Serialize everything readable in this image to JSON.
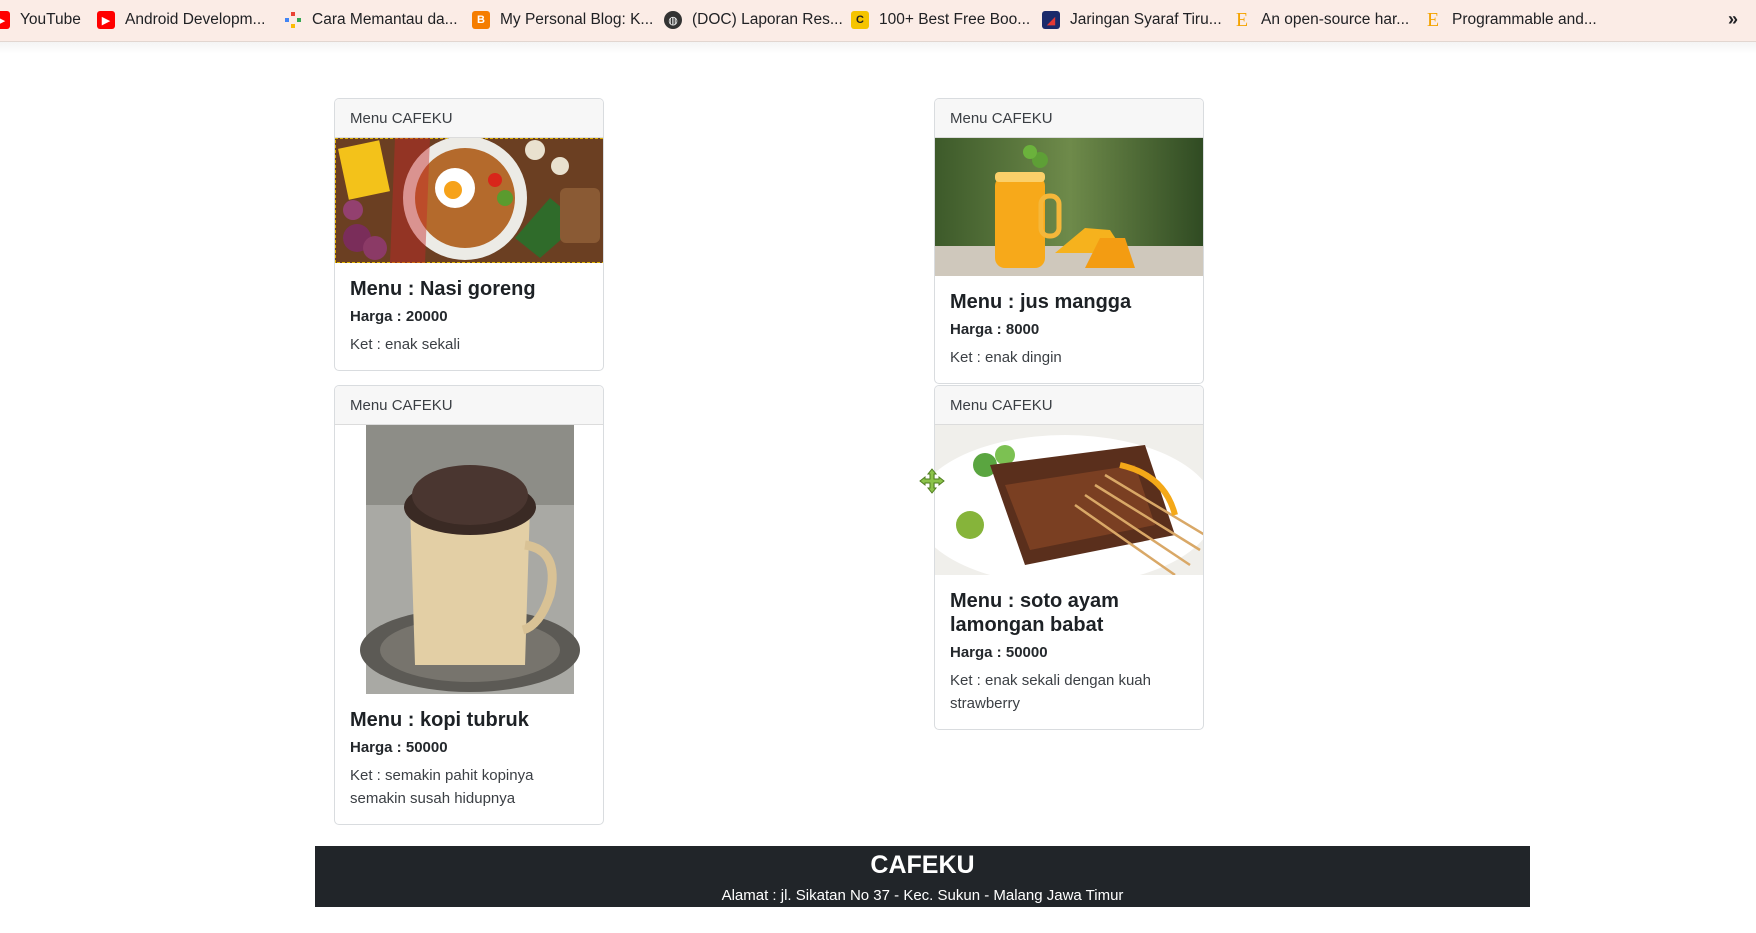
{
  "bookmarks": [
    {
      "label": "YouTube",
      "icon": "youtube-icon",
      "color": "#ff0000"
    },
    {
      "label": "Android Developm...",
      "icon": "youtube-icon",
      "color": "#ff0000"
    },
    {
      "label": "Cara Memantau da...",
      "icon": "diamond-icon",
      "color": "#4caf50"
    },
    {
      "label": "My Personal Blog: K...",
      "icon": "blogger-icon",
      "color": "#f57d00"
    },
    {
      "label": "(DOC) Laporan Res...",
      "icon": "globe-icon",
      "color": "#333333"
    },
    {
      "label": "100+ Best Free Boo...",
      "icon": "c-logo-icon",
      "color": "#f5c400"
    },
    {
      "label": "Jaringan Syaraf Tiru...",
      "icon": "site-logo-icon",
      "color": "#1b2a6b"
    },
    {
      "label": "An open-source har...",
      "icon": "e-logo-icon",
      "color": "#f4a300"
    },
    {
      "label": "Programmable and...",
      "icon": "e-logo-icon",
      "color": "#f4a300"
    }
  ],
  "more_label": "»",
  "cards": [
    {
      "header": "Menu CAFEKU",
      "title": "Menu : Nasi goreng",
      "price": "Harga : 20000",
      "desc": "Ket : enak sekali",
      "image": "nasi-goreng-photo"
    },
    {
      "header": "Menu CAFEKU",
      "title": "Menu : jus mangga",
      "price": "Harga : 8000",
      "desc": "Ket : enak dingin",
      "image": "jus-mangga-photo"
    },
    {
      "header": "Menu CAFEKU",
      "title": "Menu : kopi tubruk",
      "price": "Harga : 50000",
      "desc": "Ket : semakin pahit kopinya semakin susah hidupnya",
      "image": "kopi-tubruk-photo"
    },
    {
      "header": "Menu CAFEKU",
      "title": "Menu : soto ayam lamongan babat",
      "price": "Harga : 50000",
      "desc": "Ket : enak sekali dengan kuah strawberry",
      "image": "sate-photo"
    }
  ],
  "footer": {
    "title": "CAFEKU",
    "address": "Alamat : jl. Sikatan No 37 - Kec. Sukun - Malang Jawa Timur"
  },
  "colors": {
    "footer_bg": "#212529",
    "bookmark_bar_bg": "#fbece6"
  }
}
